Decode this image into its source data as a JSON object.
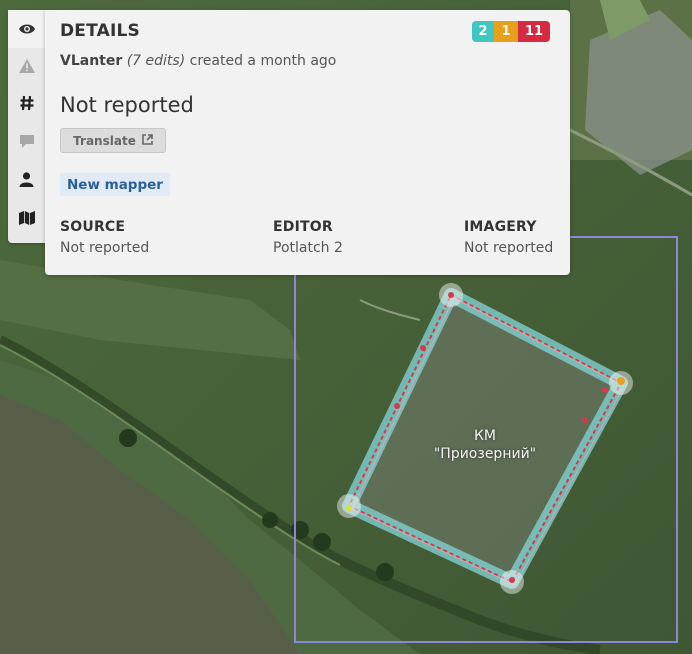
{
  "sidebar": {
    "items": [
      {
        "name": "details",
        "icon": "eye-icon",
        "active": true
      },
      {
        "name": "flags",
        "icon": "warning-icon",
        "active": false
      },
      {
        "name": "tags",
        "icon": "hashtag-icon",
        "active": false
      },
      {
        "name": "discussion",
        "icon": "comment-icon",
        "active": false
      },
      {
        "name": "user",
        "icon": "user-icon",
        "active": false
      },
      {
        "name": "map-data",
        "icon": "map-icon",
        "active": false
      }
    ]
  },
  "panel": {
    "title": "DETAILS",
    "badges": {
      "teal": "2",
      "orange": "1",
      "red": "11"
    },
    "author": {
      "name": "VLanter",
      "edits": "(7 edits)",
      "created": "created a month ago"
    },
    "comment": "Not reported",
    "translate_label": "Translate",
    "new_mapper_label": "New mapper",
    "source": {
      "label": "SOURCE",
      "value": "Not reported"
    },
    "editor": {
      "label": "EDITOR",
      "value": "Potlatch 2"
    },
    "imagery": {
      "label": "IMAGERY",
      "value": "Not reported"
    }
  },
  "map": {
    "feature_label_line1": "КМ",
    "feature_label_line2": "\"Приозерний\"",
    "colors": {
      "bbox": "#8e86d6",
      "way_casing": "#7fd0cf",
      "way_line": "#d13b4f",
      "node_highlight": "#ffffff"
    }
  }
}
